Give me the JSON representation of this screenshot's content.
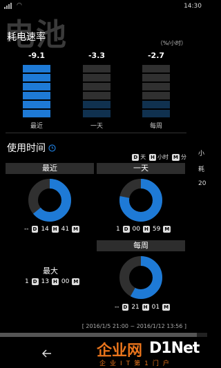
{
  "status_bar": {
    "time": "14:30"
  },
  "ghost_title": "电池",
  "drain": {
    "title": "耗电速率",
    "unit": "（%/小时）",
    "columns": [
      {
        "label": "最近",
        "value": "-9.1",
        "lit_segments": 6
      },
      {
        "label": "一天",
        "value": "-3.3",
        "lit_segments": 2
      },
      {
        "label": "每周",
        "value": "-2.7",
        "lit_segments": 2
      }
    ],
    "total_segments": 6
  },
  "usage": {
    "title": "使用时间",
    "clock_icon": "clock-icon",
    "legend": {
      "d_key": "D",
      "d_label": "天",
      "h_key": "H",
      "h_label": "小时",
      "m_key": "M",
      "m_label": "分"
    },
    "panels": {
      "recent": {
        "title": "最近",
        "fraction": 0.64,
        "d": "--",
        "h": "14",
        "m": "41"
      },
      "day": {
        "title": "一天",
        "fraction": 0.78,
        "d": "1",
        "h": "00",
        "m": "59"
      },
      "week": {
        "title": "每周",
        "fraction": 0.58,
        "d": "--",
        "h": "21",
        "m": "01"
      }
    },
    "max": {
      "label": "最大",
      "d": "1",
      "h": "13",
      "m": "00"
    },
    "range": "[ 2016/1/5 21:00 ~ 2016/1/12 13:56 ]"
  },
  "right_peek": {
    "line1": "小",
    "line2": "耗",
    "line3": "20"
  },
  "colors": {
    "accent": "#1e7ad6",
    "dim": "#303030",
    "dim_blue": "#10314f"
  },
  "watermark": {
    "main": "企业网",
    "net": "D1Net",
    "sub": "企业IT第1门户"
  }
}
